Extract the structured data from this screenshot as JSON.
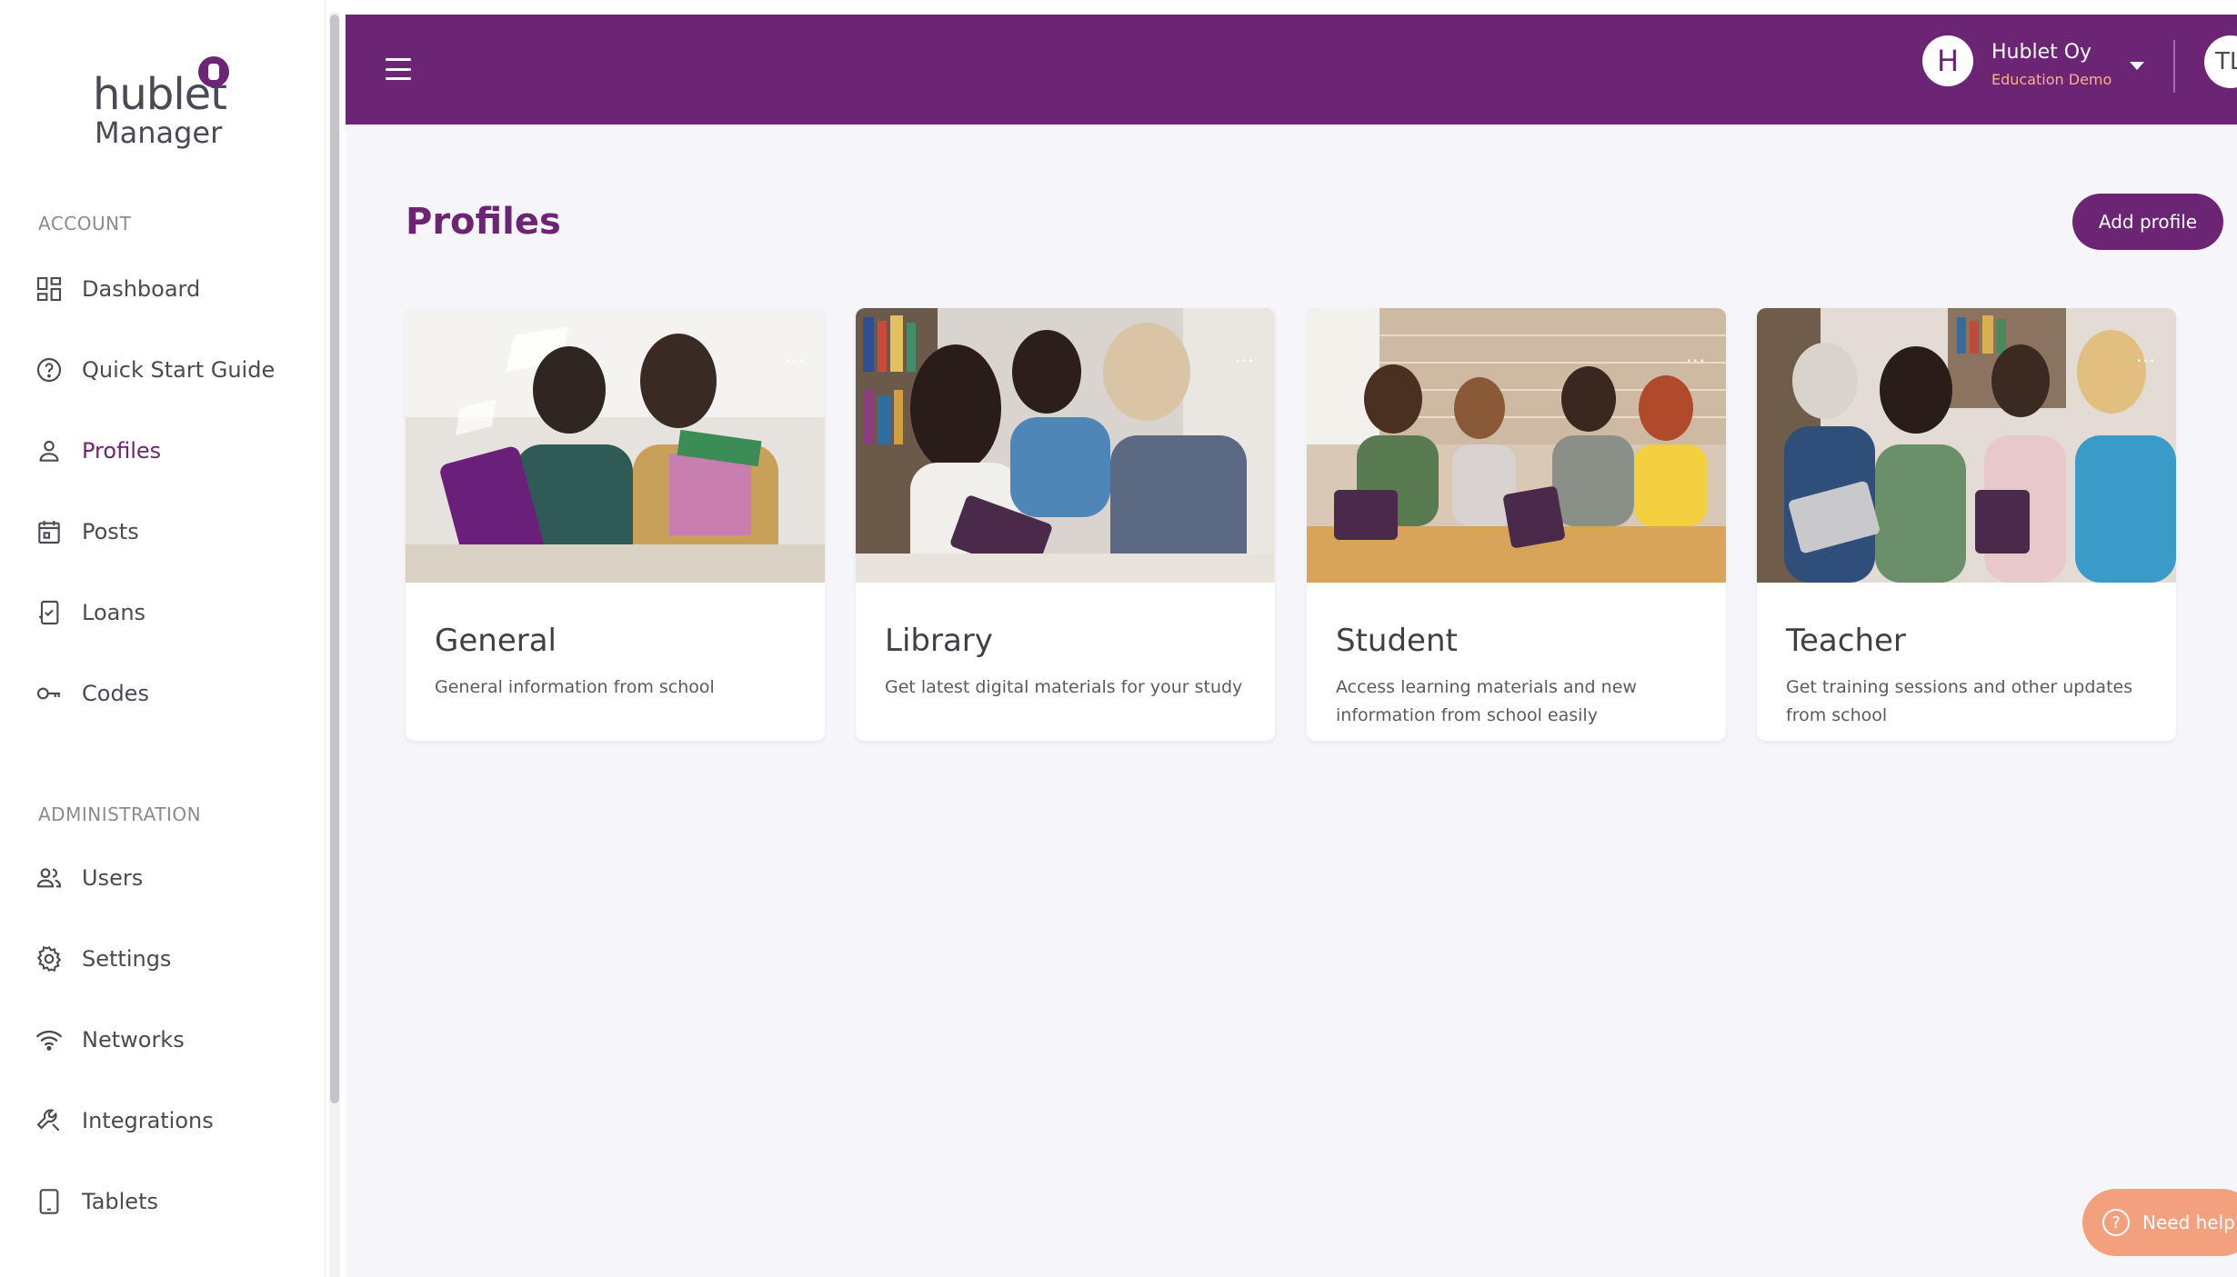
{
  "brand": {
    "logo_word": "hublet",
    "logo_sub": "Manager",
    "accent": "#6c2475",
    "orange": "#f3a07f"
  },
  "sidebar": {
    "account_label": "ACCOUNT",
    "admin_label": "ADMINISTRATION",
    "account_items": [
      {
        "label": "Dashboard",
        "icon": "dashboard-icon"
      },
      {
        "label": "Quick Start Guide",
        "icon": "question-circle-icon"
      },
      {
        "label": "Profiles",
        "icon": "person-icon",
        "active": true
      },
      {
        "label": "Posts",
        "icon": "calendar-icon"
      },
      {
        "label": "Loans",
        "icon": "tablet-loan-icon"
      },
      {
        "label": "Codes",
        "icon": "key-icon"
      }
    ],
    "admin_items": [
      {
        "label": "Users",
        "icon": "users-icon"
      },
      {
        "label": "Settings",
        "icon": "gear-icon"
      },
      {
        "label": "Networks",
        "icon": "wifi-icon"
      },
      {
        "label": "Integrations",
        "icon": "wrench-icon"
      },
      {
        "label": "Tablets",
        "icon": "tablet-icon"
      }
    ]
  },
  "topbar": {
    "org_initial": "H",
    "org_name": "Hublet Oy",
    "org_sub": "Education Demo",
    "user_initials": "TL"
  },
  "main": {
    "title": "Profiles",
    "add_button": "Add profile",
    "cards": [
      {
        "title": "General",
        "description": "General information from school",
        "menu": "..."
      },
      {
        "title": "Library",
        "description": "Get latest digital materials for your study",
        "menu": "..."
      },
      {
        "title": "Student",
        "description": "Access learning materials and new information from school easily",
        "menu": "..."
      },
      {
        "title": "Teacher",
        "description": "Get training sessions and other updates from school",
        "menu": "..."
      }
    ]
  },
  "help": {
    "label": "Need help?"
  }
}
